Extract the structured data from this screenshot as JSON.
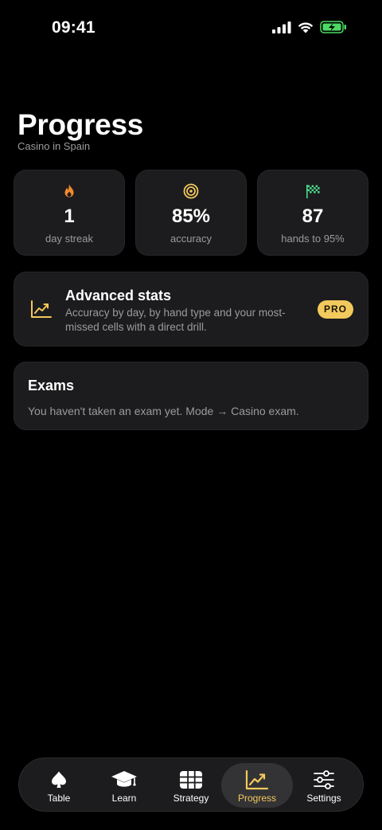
{
  "status_bar": {
    "time": "09:41"
  },
  "header": {
    "title": "Progress",
    "subtitle": "Casino in Spain"
  },
  "stats": [
    {
      "icon": "flame-icon",
      "value": "1",
      "label": "day streak",
      "color": "#f28a2e"
    },
    {
      "icon": "target-icon",
      "value": "85%",
      "label": "accuracy",
      "color": "#f2c95c"
    },
    {
      "icon": "checkered-flag-icon",
      "value": "87",
      "label": "hands to 95%",
      "color": "#4cd98a"
    }
  ],
  "advanced": {
    "title": "Advanced stats",
    "description": "Accuracy by day, by hand type and your most-missed cells with a direct drill.",
    "badge": "PRO",
    "accent": "#f2c95c"
  },
  "exams": {
    "title": "Exams",
    "text": "You haven't taken an exam yet. Mode → Casino exam."
  },
  "tabbar": {
    "tabs": [
      {
        "label": "Table",
        "icon": "spade-icon",
        "active": false
      },
      {
        "label": "Learn",
        "icon": "graduation-cap-icon",
        "active": false
      },
      {
        "label": "Strategy",
        "icon": "grid-icon",
        "active": false
      },
      {
        "label": "Progress",
        "icon": "chart-line-icon",
        "active": true
      },
      {
        "label": "Settings",
        "icon": "sliders-icon",
        "active": false
      }
    ],
    "active_color": "#f2c95c"
  }
}
